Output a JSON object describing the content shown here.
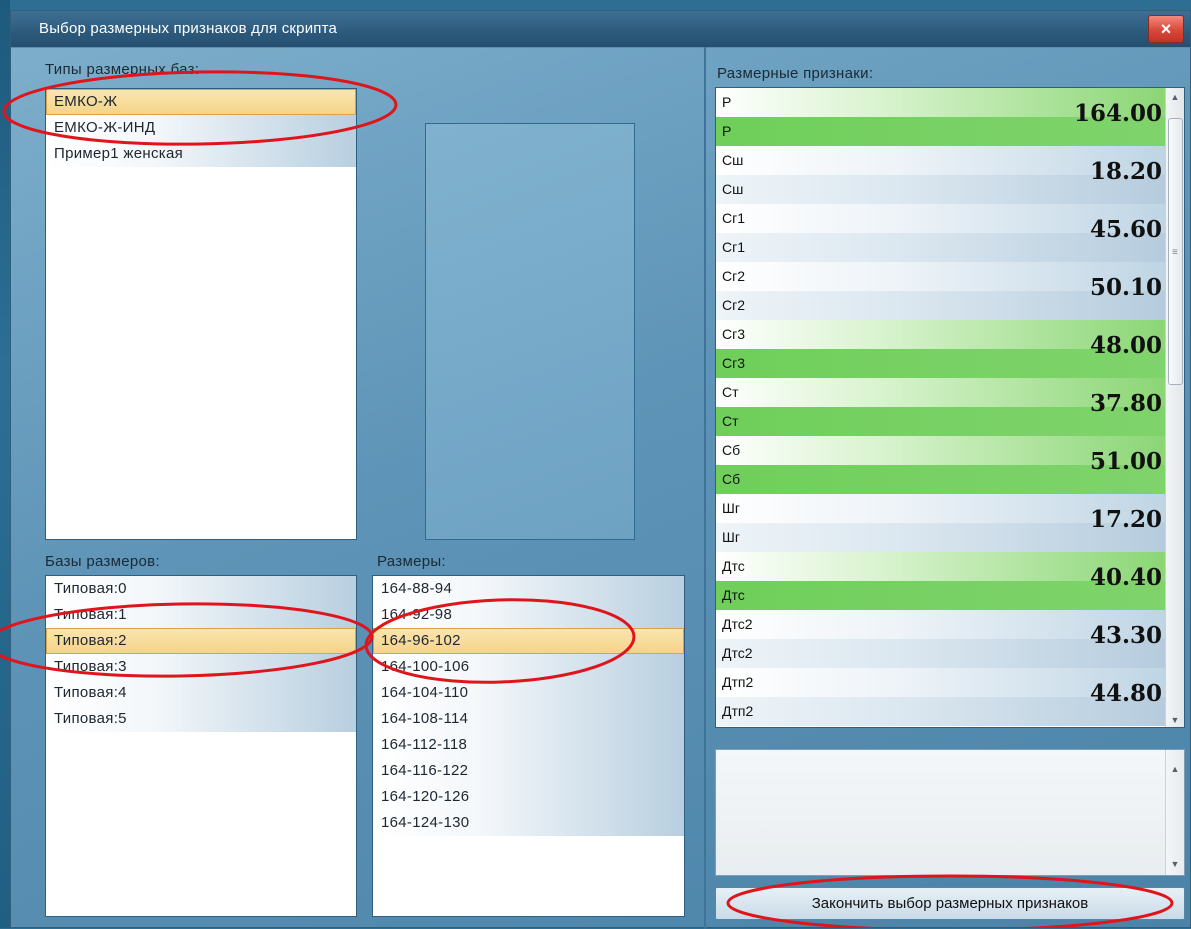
{
  "window": {
    "title": "Выбор размерных признаков для скрипта",
    "close_glyph": "×"
  },
  "base_types": {
    "label": "Типы размерных баз:",
    "items": [
      "ЕМКО-Ж",
      "ЕМКО-Ж-ИНД",
      "Пример1 женская"
    ],
    "selected": "ЕМКО-Ж"
  },
  "size_bases": {
    "label": "Базы размеров:",
    "items": [
      "Типовая:0",
      "Типовая:1",
      "Типовая:2",
      "Типовая:3",
      "Типовая:4",
      "Типовая:5"
    ],
    "selected": "Типовая:2"
  },
  "sizes": {
    "label": "Размеры:",
    "items": [
      "164-88-94",
      "164-92-98",
      "164-96-102",
      "164-100-106",
      "164-104-110",
      "164-108-114",
      "164-112-118",
      "164-116-122",
      "164-120-126",
      "164-124-130"
    ],
    "selected": "164-96-102"
  },
  "dimensional_features": {
    "label": "Размерные признаки:",
    "items": [
      {
        "code": "Р",
        "name": "Р",
        "value": "164.00",
        "highlighted": true
      },
      {
        "code": "Сш",
        "name": "Сш",
        "value": "18.20",
        "highlighted": false
      },
      {
        "code": "Сг1",
        "name": "Сг1",
        "value": "45.60",
        "highlighted": false
      },
      {
        "code": "Сг2",
        "name": "Сг2",
        "value": "50.10",
        "highlighted": false
      },
      {
        "code": "Сг3",
        "name": "Сг3",
        "value": "48.00",
        "highlighted": true
      },
      {
        "code": "Ст",
        "name": "Ст",
        "value": "37.80",
        "highlighted": true
      },
      {
        "code": "Сб",
        "name": "Сб",
        "value": "51.00",
        "highlighted": true
      },
      {
        "code": "Шг",
        "name": "Шг",
        "value": "17.20",
        "highlighted": false
      },
      {
        "code": "Дтс",
        "name": "Дтс",
        "value": "40.40",
        "highlighted": true
      },
      {
        "code": "Дтс2",
        "name": "Дтс2",
        "value": "43.30",
        "highlighted": false
      },
      {
        "code": "Дтп2",
        "name": "Дтп2",
        "value": "44.80",
        "highlighted": false
      }
    ],
    "scroll_up": "▲",
    "scroll_down": "▼",
    "scroll_grip": "≡"
  },
  "notes": {
    "text": "",
    "scroll_up": "▲",
    "scroll_down": "▼"
  },
  "finish_button": {
    "label": "Закончить выбор размерных признаков"
  },
  "colors": {
    "selection_fill": "#f4d387",
    "highlight_green": "#78d164",
    "annotation_red": "#e0141b"
  }
}
